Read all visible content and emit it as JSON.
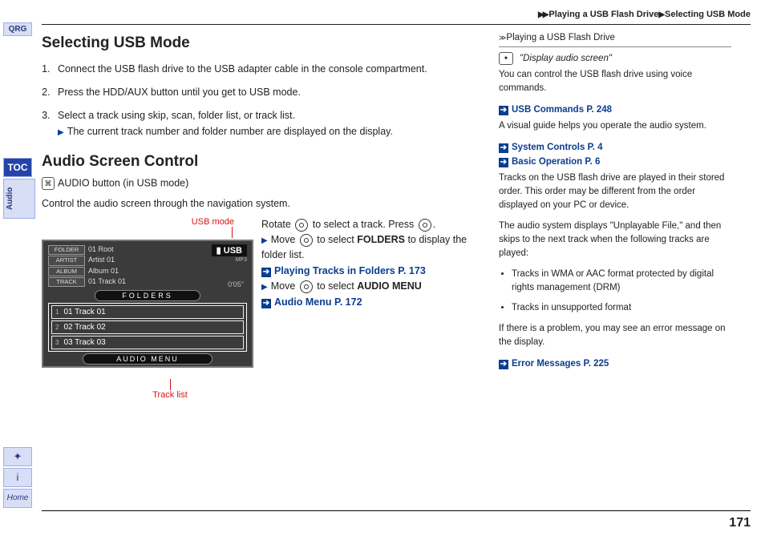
{
  "breadcrumb": {
    "level1": "Playing a USB Flash Drive",
    "level2": "Selecting USB Mode"
  },
  "leftTabs": {
    "qrg": "QRG",
    "toc": "TOC",
    "section": "Audio"
  },
  "leftBottom": {
    "voice": "✦",
    "info": "i",
    "home": "Home"
  },
  "pageNumber": "171",
  "h1": "Selecting USB Mode",
  "steps": {
    "s1": "Connect the USB flash drive to the USB adapter cable in the console compartment.",
    "s2": "Press the HDD/AUX button until you get to USB mode.",
    "s3": "Select a track using skip, scan, folder list, or track list."
  },
  "subnote": "The current track number and folder number are displayed on the display.",
  "h2": "Audio Screen Control",
  "caption": "AUDIO button (in USB mode)",
  "body1": "Control the audio screen through the navigation system.",
  "annot": {
    "top": "USB mode",
    "bottom": "Track list"
  },
  "screen": {
    "folderLab": "FOLDER",
    "folder": "01 Root",
    "artistLab": "ARTIST",
    "artist": "Artist 01",
    "albumLab": "ALBUM",
    "album": "Album 01",
    "trackLab": "TRACK",
    "track": "01 Track 01",
    "usbIcon": "▮",
    "usb": "USB",
    "mp3": "MP3",
    "time": "0'05\"",
    "pillFolders": "FOLDERS",
    "rows": {
      "r1i": "1",
      "r1": "01 Track 01",
      "r2i": "2",
      "r2": "02 Track 02",
      "r3i": "3",
      "r3": "03 Track 03"
    },
    "pillAudio": "AUDIO MENU"
  },
  "instr": {
    "line1a": "Rotate ",
    "line1b": " to select a track. Press ",
    "line1c": ".",
    "line2a": "Move ",
    "line2b": " to select ",
    "foldersWord": "FOLDERS",
    "line2c": " to display the folder list.",
    "link1": "Playing Tracks in Folders",
    "link1p": "P. 173",
    "line3a": "Move ",
    "line3b": " to select ",
    "audiomenuWord": "AUDIO MENU",
    "link2": "Audio Menu",
    "link2p": "P. 172"
  },
  "sidebar": {
    "head": "Playing a USB Flash Drive",
    "quote": "\"Display audio screen\"",
    "p1": "You can control the USB flash drive using voice commands.",
    "l1": "USB Commands",
    "l1p": "P. 248",
    "p2": "A visual guide helps you operate the audio system.",
    "l2": "System Controls",
    "l2p": "P. 4",
    "l3": "Basic Operation",
    "l3p": "P. 6",
    "p3": "Tracks on the USB flash drive are played in their stored order. This order may be different from the order displayed on your PC or device.",
    "p4": "The audio system displays \"Unplayable File,\" and then skips to the next track when the following tracks are played:",
    "b1": "Tracks in WMA or AAC format protected by digital rights management (DRM)",
    "b2": "Tracks in unsupported format",
    "p5": "If there is a problem, you may see an error message on the display.",
    "l4": "Error Messages",
    "l4p": "P. 225"
  }
}
